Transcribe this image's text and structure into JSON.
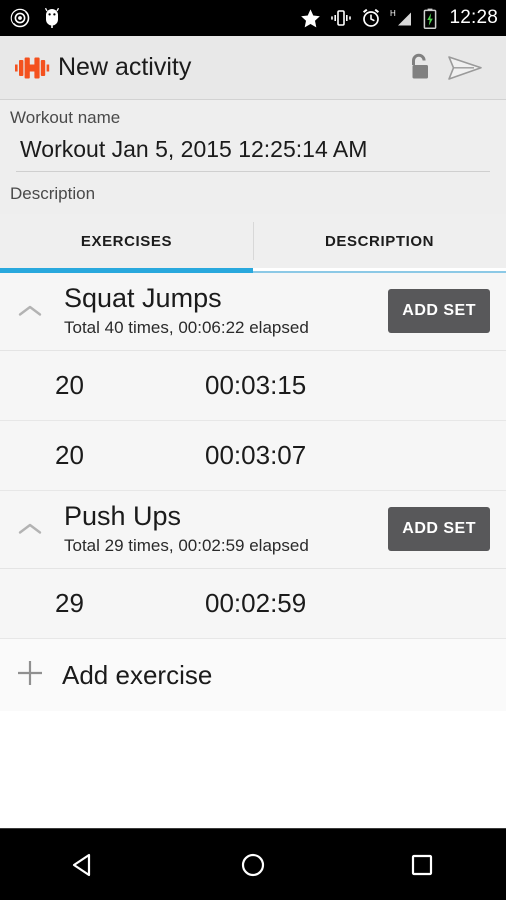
{
  "status_bar": {
    "left_icons": [
      "cast-icon",
      "android-bug-icon"
    ],
    "right_icons": [
      "star-icon",
      "vibrate-icon",
      "alarm-icon",
      "signal-h-icon",
      "battery-charging-icon"
    ],
    "clock": "12:28"
  },
  "app_bar": {
    "logo": "dumbbell-icon",
    "title": "New activity",
    "lock_icon": "unlock-icon",
    "send_icon": "send-icon",
    "accent_color": "#f4511e",
    "background": "#e8e8e8"
  },
  "form": {
    "name_label": "Workout name",
    "name_value": "Workout Jan 5, 2015 12:25:14 AM",
    "name_placeholder": "Workout name",
    "description_label": "Description"
  },
  "tabs": {
    "active_index": 0,
    "active_color": "#29a8dd",
    "inactive_color": "#8cc9e6",
    "items": [
      {
        "label": "EXERCISES"
      },
      {
        "label": "DESCRIPTION"
      }
    ]
  },
  "exercises": [
    {
      "name": "Squat Jumps",
      "summary": "Total 40 times, 00:06:22 elapsed",
      "collapse_icon": "chevron-up-icon",
      "add_set_label": "ADD SET",
      "sets": [
        {
          "reps": "20",
          "time": "00:03:15"
        },
        {
          "reps": "20",
          "time": "00:03:07"
        }
      ]
    },
    {
      "name": "Push Ups",
      "summary": "Total 29 times, 00:02:59 elapsed",
      "collapse_icon": "chevron-up-icon",
      "add_set_label": "ADD SET",
      "sets": [
        {
          "reps": "29",
          "time": "00:02:59"
        }
      ]
    }
  ],
  "add_exercise": {
    "icon": "plus-icon",
    "label": "Add exercise"
  },
  "nav_bar": {
    "back": "back-triangle-icon",
    "home": "home-circle-icon",
    "recents": "recents-square-icon"
  }
}
